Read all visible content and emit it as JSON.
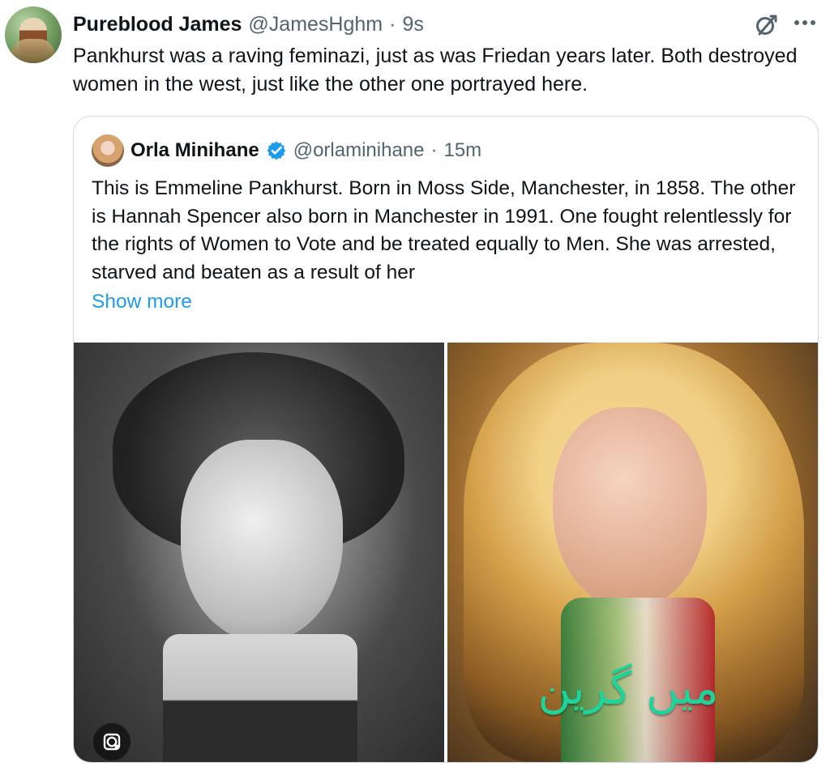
{
  "tweet": {
    "author_name": "Pureblood James",
    "author_handle": "@JamesHghm",
    "separator": "·",
    "time": "9s",
    "text": "Pankhurst was a raving feminazi, just as was Friedan years later. Both destroyed women in the west, just like the other one portrayed here."
  },
  "icons": {
    "grok": "grok-icon",
    "more": "more-icon",
    "verified": "verified-badge",
    "lens": "image-search-icon"
  },
  "quoted_tweet": {
    "author_name": "Orla Minihane",
    "author_handle": "@orlaminihane",
    "separator": "·",
    "time": "15m",
    "text": "This is Emmeline Pankhurst. Born in Moss Side, Manchester, in 1858. The other is Hannah Spencer also  born in Manchester in 1991. One fought relentlessly for the rights of Women to Vote and be treated equally to Men. She was arrested, starved and beaten as a result of her",
    "show_more": "Show more",
    "media": {
      "right_caption": "میں گرین"
    }
  },
  "colors": {
    "text_primary": "#0f1419",
    "text_secondary": "#536471",
    "link": "#1d9bf0",
    "border": "#cfd9de",
    "verified": "#1d9bf0",
    "caption": "#20d39a"
  }
}
